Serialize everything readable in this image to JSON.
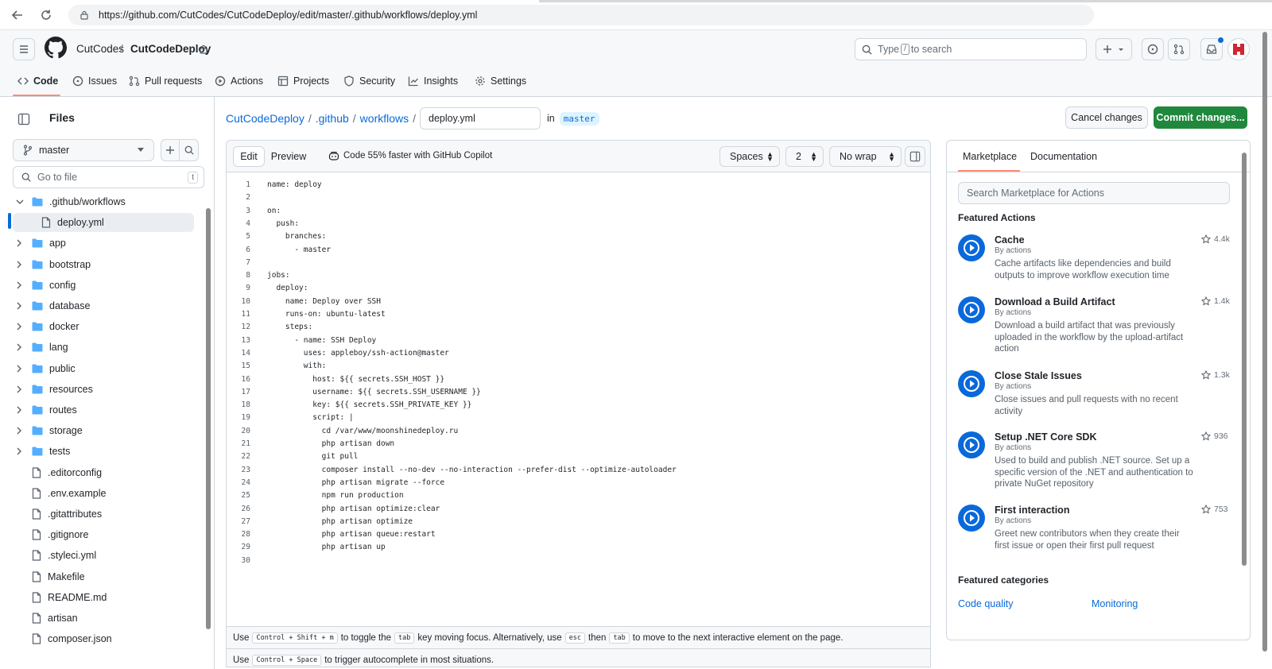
{
  "browser": {
    "url": "https://github.com/CutCodes/CutCodeDeploy/edit/master/.github/workflows/deploy.yml"
  },
  "header": {
    "owner": "CutCodes",
    "separator": "/",
    "repo": "CutCodeDeploy",
    "search_prefix": "Type",
    "search_key": "/",
    "search_suffix": "to search",
    "tabs": [
      {
        "label": "Code",
        "icon": "code-icon"
      },
      {
        "label": "Issues",
        "icon": "issue-icon"
      },
      {
        "label": "Pull requests",
        "icon": "pull-request-icon"
      },
      {
        "label": "Actions",
        "icon": "play-icon"
      },
      {
        "label": "Projects",
        "icon": "table-icon"
      },
      {
        "label": "Security",
        "icon": "shield-icon"
      },
      {
        "label": "Insights",
        "icon": "graph-icon"
      },
      {
        "label": "Settings",
        "icon": "gear-icon"
      }
    ],
    "active_color": "#fd8c73"
  },
  "sidebar": {
    "title": "Files",
    "branch": "master",
    "goto_placeholder": "Go to file",
    "goto_key": "t",
    "items": [
      {
        "label": ".github/workflows",
        "type": "folder",
        "expanded": true
      },
      {
        "label": "deploy.yml",
        "type": "file",
        "selected": true
      },
      {
        "label": "app",
        "type": "folder"
      },
      {
        "label": "bootstrap",
        "type": "folder"
      },
      {
        "label": "config",
        "type": "folder"
      },
      {
        "label": "database",
        "type": "folder"
      },
      {
        "label": "docker",
        "type": "folder"
      },
      {
        "label": "lang",
        "type": "folder"
      },
      {
        "label": "public",
        "type": "folder"
      },
      {
        "label": "resources",
        "type": "folder"
      },
      {
        "label": "routes",
        "type": "folder"
      },
      {
        "label": "storage",
        "type": "folder"
      },
      {
        "label": "tests",
        "type": "folder"
      },
      {
        "label": ".editorconfig",
        "type": "file"
      },
      {
        "label": ".env.example",
        "type": "file"
      },
      {
        "label": ".gitattributes",
        "type": "file"
      },
      {
        "label": ".gitignore",
        "type": "file"
      },
      {
        "label": ".styleci.yml",
        "type": "file"
      },
      {
        "label": "Makefile",
        "type": "file"
      },
      {
        "label": "README.md",
        "type": "file"
      },
      {
        "label": "artisan",
        "type": "file"
      },
      {
        "label": "composer.json",
        "type": "file"
      }
    ]
  },
  "editor": {
    "path": [
      "CutCodeDeploy",
      ".github",
      "workflows"
    ],
    "filename": "deploy.yml",
    "in_label": "in",
    "branch": "master",
    "cancel_label": "Cancel changes",
    "commit_label": "Commit changes...",
    "tab_edit": "Edit",
    "tab_preview": "Preview",
    "copilot": "Code 55% faster with GitHub Copilot",
    "indent_mode": "Spaces",
    "indent_size": "2",
    "wrap_mode": "No wrap",
    "lines": [
      "name: deploy",
      "",
      "on:",
      "  push:",
      "    branches:",
      "      - master",
      "",
      "jobs:",
      "  deploy:",
      "    name: Deploy over SSH",
      "    runs-on: ubuntu-latest",
      "    steps:",
      "      - name: SSH Deploy",
      "        uses: appleboy/ssh-action@master",
      "        with:",
      "          host: ${{ secrets.SSH_HOST }}",
      "          username: ${{ secrets.SSH_USERNAME }}",
      "          key: ${{ secrets.SSH_PRIVATE_KEY }}",
      "          script: |",
      "            cd /var/www/moonshinedeploy.ru",
      "            php artisan down",
      "            git pull",
      "            composer install --no-dev --no-interaction --prefer-dist --optimize-autoloader",
      "            php artisan migrate --force",
      "            npm run production",
      "            php artisan optimize:clear",
      "            php artisan optimize",
      "            php artisan queue:restart",
      "            php artisan up",
      ""
    ],
    "hint1": {
      "a": "Use",
      "k1": "Control + Shift + m",
      "b": "to toggle the",
      "k2": "tab",
      "c": "key moving focus. Alternatively, use",
      "k3": "esc",
      "d": "then",
      "k4": "tab",
      "e": "to move to the next interactive element on the page."
    },
    "hint2": {
      "a": "Use",
      "k1": "Control + Space",
      "b": "to trigger autocomplete in most situations."
    }
  },
  "marketplace": {
    "tab_marketplace": "Marketplace",
    "tab_docs": "Documentation",
    "search_placeholder": "Search Marketplace for Actions",
    "featured_title": "Featured Actions",
    "actions": [
      {
        "name": "Cache",
        "by": "By actions",
        "desc": "Cache artifacts like dependencies and build outputs to improve workflow execution time",
        "stars": "4.4k"
      },
      {
        "name": "Download a Build Artifact",
        "by": "By actions",
        "desc": "Download a build artifact that was previously uploaded in the workflow by the upload-artifact action",
        "stars": "1.4k"
      },
      {
        "name": "Close Stale Issues",
        "by": "By actions",
        "desc": "Close issues and pull requests with no recent activity",
        "stars": "1.3k"
      },
      {
        "name": "Setup .NET Core SDK",
        "by": "By actions",
        "desc": "Used to build and publish .NET source. Set up a specific version of the .NET and authentication to private NuGet repository",
        "stars": "936"
      },
      {
        "name": "First interaction",
        "by": "By actions",
        "desc": "Greet new contributors when they create their first issue or open their first pull request",
        "stars": "753"
      }
    ],
    "categories_title": "Featured categories",
    "categories": [
      "Code quality",
      "Monitoring"
    ]
  },
  "colors": {
    "link": "#0969da",
    "commit": "#1f883d",
    "border": "#d0d7de"
  }
}
